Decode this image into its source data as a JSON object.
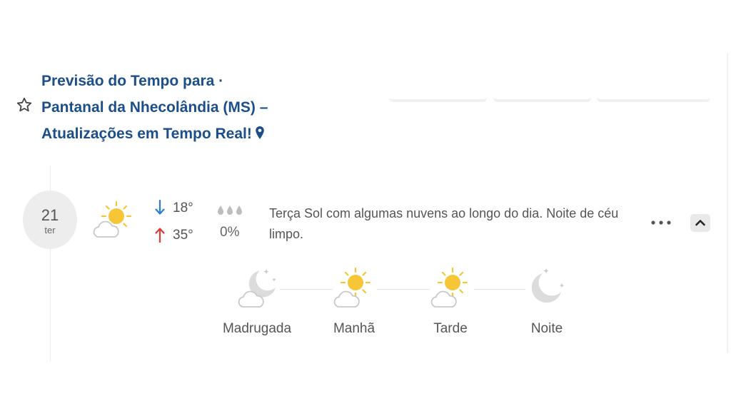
{
  "header": {
    "title": "Previsão do Tempo para Pantanal da Nhecolândia (MS) – Atualizações em Tempo Real!",
    "title_lines": [
      "Previsão do Tempo para ·",
      "Pantanal da Nhecolândia (MS) –",
      "Atualizações em Tempo Real!"
    ],
    "favorite_icon": "star-outline-icon",
    "location_icon": "map-pin-icon"
  },
  "day": {
    "date": "21",
    "weekday": "ter",
    "condition_icon": "sun-behind-cloud-icon",
    "temp_min": "18°",
    "temp_max": "35°",
    "precip_icon": "raindrops-icon",
    "precip_chance": "0%",
    "description": "Terça Sol com algumas nuvens ao longo do dia. Noite de céu limpo."
  },
  "periods": [
    {
      "label": "Madrugada",
      "icon": "moon-cloud-icon"
    },
    {
      "label": "Manhã",
      "icon": "sun-cloud-icon"
    },
    {
      "label": "Tarde",
      "icon": "sun-cloud-icon"
    },
    {
      "label": "Noite",
      "icon": "moon-stars-icon"
    }
  ],
  "colors": {
    "title": "#1c4f8a",
    "arrow_down": "#2b7bd6",
    "arrow_up": "#e53935",
    "sun": "#f7c636",
    "moon": "#d6d6d6"
  }
}
